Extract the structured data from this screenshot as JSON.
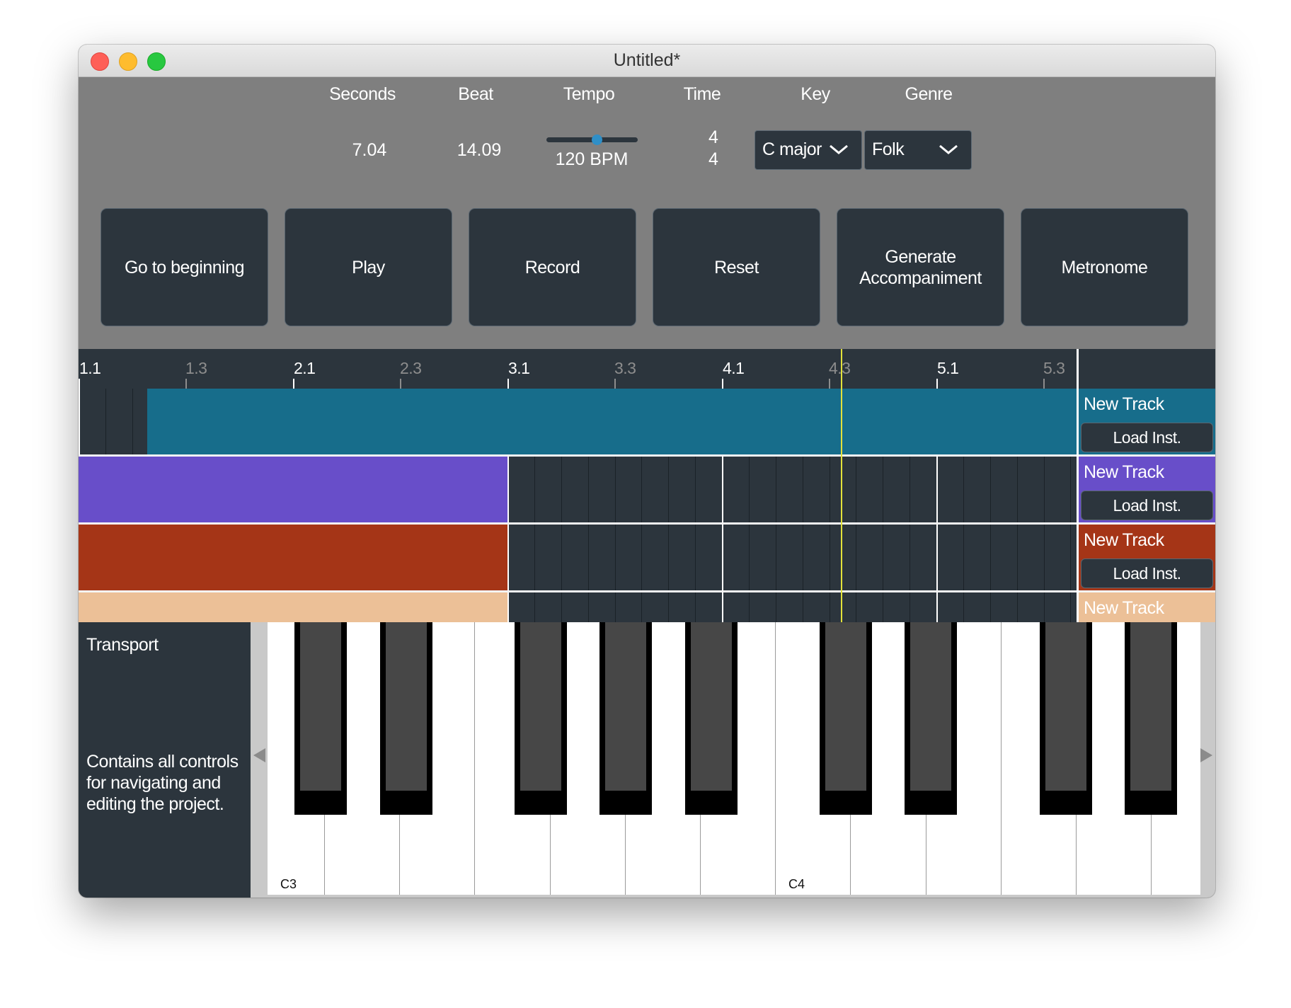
{
  "window": {
    "title": "Untitled*"
  },
  "header": {
    "seconds_label": "Seconds",
    "beat_label": "Beat",
    "tempo_label": "Tempo",
    "time_label": "Time",
    "key_label": "Key",
    "genre_label": "Genre",
    "seconds_value": "7.04",
    "beat_value": "14.09",
    "tempo_value": "120 BPM",
    "tempo_slider_fraction": 0.55,
    "time_sig_top": "4",
    "time_sig_bottom": "4",
    "key_select": "C major",
    "genre_select": "Folk"
  },
  "transport": {
    "go_to_beginning": "Go to beginning",
    "play": "Play",
    "record": "Record",
    "reset": "Reset",
    "generate_accompaniment": "Generate Accompaniment",
    "metronome": "Metronome"
  },
  "ruler": {
    "major_labels": [
      "1.1",
      "2.1",
      "3.1",
      "4.1",
      "5.1"
    ],
    "minor_labels": [
      "1.3",
      "2.3",
      "3.3",
      "4.3",
      "5.3"
    ]
  },
  "tracks": [
    {
      "name": "New Track",
      "load_label": "Load Inst.",
      "color": "#176d8b"
    },
    {
      "name": "New Track",
      "load_label": "Load Inst.",
      "color": "#684ec9"
    },
    {
      "name": "New Track",
      "load_label": "Load Inst.",
      "color": "#a53517"
    },
    {
      "name": "New Track",
      "color": "#ecc097"
    }
  ],
  "info_panel": {
    "title": "Transport",
    "body": "Contains all controls for navigating and editing the project."
  },
  "piano": {
    "labels": [
      "C3",
      "C4"
    ]
  },
  "icons": {
    "key_dropdown": "chevron-down-icon",
    "genre_dropdown": "chevron-down-icon",
    "scroll_left": "triangle-left-icon",
    "scroll_right": "triangle-right-icon"
  },
  "colors": {
    "panel_dark": "#2c353d",
    "window_gray": "#7f7f7f",
    "playhead": "#e3e23a",
    "tempo_thumb": "#2f8fc7"
  }
}
